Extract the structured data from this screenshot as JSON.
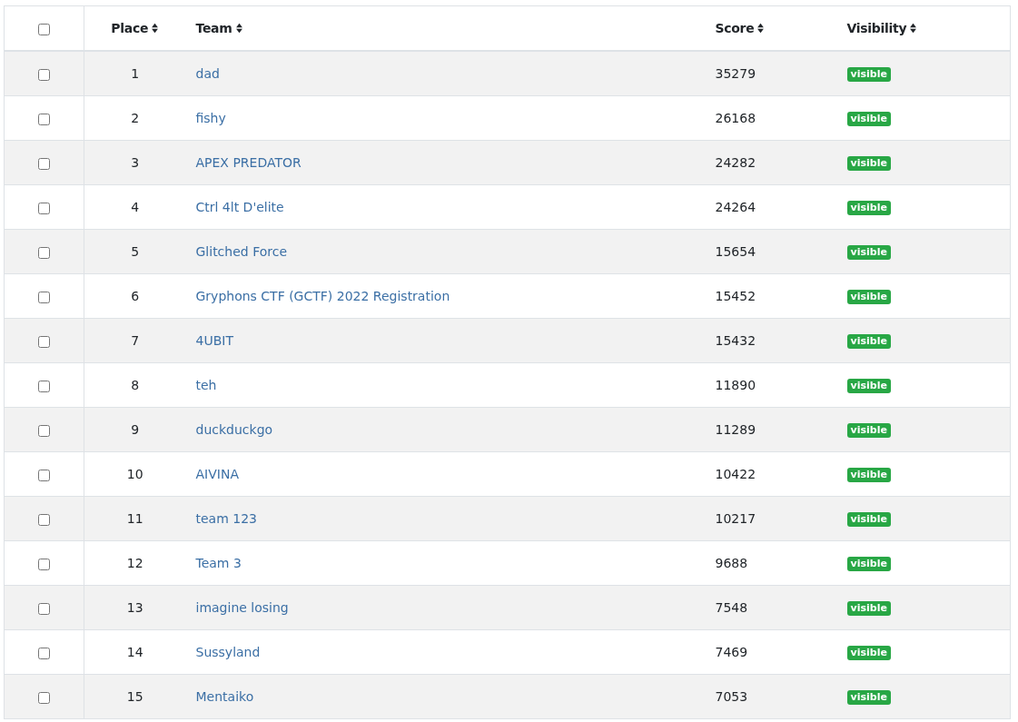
{
  "table": {
    "select_all": {
      "checked": false
    },
    "columns": [
      {
        "label": "Place",
        "sortable": true
      },
      {
        "label": "Team",
        "sortable": true
      },
      {
        "label": "Score",
        "sortable": true
      },
      {
        "label": "Visibility",
        "sortable": true
      }
    ],
    "rows": [
      {
        "checked": false,
        "place": "1",
        "team": "dad",
        "score": "35279",
        "visibility": {
          "label": "visible",
          "kind": "visible"
        }
      },
      {
        "checked": false,
        "place": "2",
        "team": "fishy",
        "score": "26168",
        "visibility": {
          "label": "visible",
          "kind": "visible"
        }
      },
      {
        "checked": false,
        "place": "3",
        "team": "APEX PREDATOR",
        "score": "24282",
        "visibility": {
          "label": "visible",
          "kind": "visible"
        }
      },
      {
        "checked": false,
        "place": "4",
        "team": "Ctrl 4lt D'elite",
        "score": "24264",
        "visibility": {
          "label": "visible",
          "kind": "visible"
        }
      },
      {
        "checked": false,
        "place": "5",
        "team": "Glitched Force",
        "score": "15654",
        "visibility": {
          "label": "visible",
          "kind": "visible"
        }
      },
      {
        "checked": false,
        "place": "6",
        "team": "Gryphons CTF (GCTF) 2022 Registration",
        "score": "15452",
        "visibility": {
          "label": "visible",
          "kind": "visible"
        }
      },
      {
        "checked": false,
        "place": "7",
        "team": "4UBIT",
        "score": "15432",
        "visibility": {
          "label": "visible",
          "kind": "visible"
        }
      },
      {
        "checked": false,
        "place": "8",
        "team": "teh",
        "score": "11890",
        "visibility": {
          "label": "visible",
          "kind": "visible"
        }
      },
      {
        "checked": false,
        "place": "9",
        "team": "duckduckgo",
        "score": "11289",
        "visibility": {
          "label": "visible",
          "kind": "visible"
        }
      },
      {
        "checked": false,
        "place": "10",
        "team": "AIVINA",
        "score": "10422",
        "visibility": {
          "label": "visible",
          "kind": "visible"
        }
      },
      {
        "checked": false,
        "place": "11",
        "team": "team 123",
        "score": "10217",
        "visibility": {
          "label": "visible",
          "kind": "visible"
        }
      },
      {
        "checked": false,
        "place": "12",
        "team": "Team 3",
        "score": "9688",
        "visibility": {
          "label": "visible",
          "kind": "visible"
        }
      },
      {
        "checked": false,
        "place": "13",
        "team": "imagine losing",
        "score": "7548",
        "visibility": {
          "label": "visible",
          "kind": "visible"
        }
      },
      {
        "checked": false,
        "place": "14",
        "team": "Sussyland",
        "score": "7469",
        "visibility": {
          "label": "visible",
          "kind": "visible"
        }
      },
      {
        "checked": false,
        "place": "15",
        "team": "Mentaiko",
        "score": "7053",
        "visibility": {
          "label": "visible",
          "kind": "visible"
        }
      }
    ]
  }
}
